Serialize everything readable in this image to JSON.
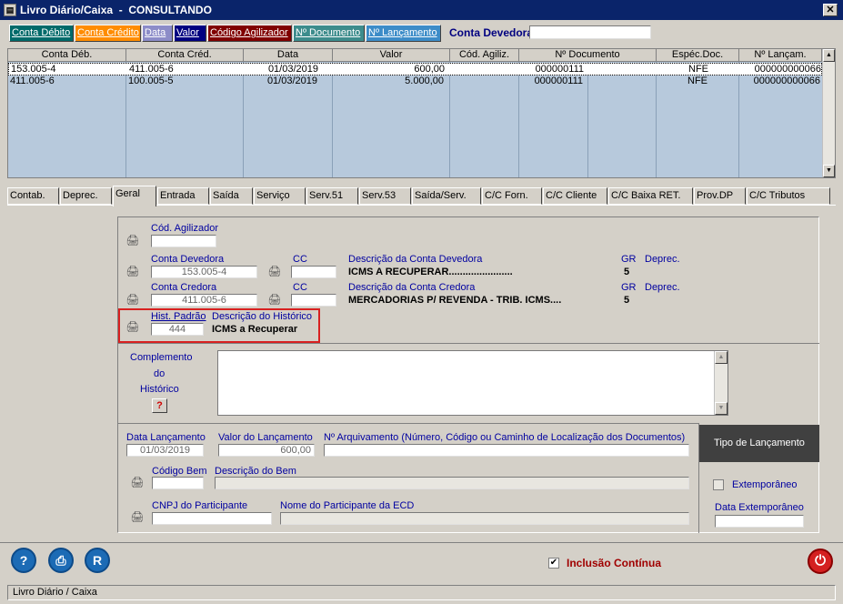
{
  "window": {
    "title": "Livro Diário/Caixa  -  CONSULTANDO",
    "app_icon": "ledger-icon",
    "close": "✕"
  },
  "sort_buttons": [
    {
      "label": "Conta Débito",
      "bg": "#006a6a",
      "fg": "#ffffff"
    },
    {
      "label": "Conta Crédito",
      "bg": "#ff8c00",
      "fg": "#ffffff"
    },
    {
      "label": "Data",
      "bg": "#8c8cc8",
      "fg": "#ffffff"
    },
    {
      "label": "Valor",
      "bg": "#000080",
      "fg": "#ffffff"
    },
    {
      "label": "Código Agilizador",
      "bg": "#800000",
      "fg": "#ffffff"
    },
    {
      "label": "Nº Documento",
      "bg": "#3c8c8c",
      "fg": "#ffffff"
    },
    {
      "label": "Nº Lançamento",
      "bg": "#3c8cc8",
      "fg": "#ffffff"
    }
  ],
  "conta_devedora_label": "Conta Devedora",
  "conta_devedora_value": "",
  "grid": {
    "headers": [
      "Conta Déb.",
      "Conta Créd.",
      "Data",
      "Valor",
      "Cód. Agiliz.",
      "Nº Documento",
      "Espéc.Doc.",
      "Nº Lançam."
    ],
    "rows": [
      [
        "153.005-4",
        "411.005-6",
        "01/03/2019",
        "600,00",
        "",
        "000000111",
        "NFE",
        "000000000066"
      ],
      [
        "411.005-6",
        "100.005-5",
        "01/03/2019",
        "5.000,00",
        "",
        "000000111",
        "NFE",
        "000000000066"
      ]
    ]
  },
  "tabs": [
    "Contab.",
    "Deprec.",
    "Geral",
    "Entrada",
    "Saída",
    "Serviço",
    "Serv.51",
    "Serv.53",
    "Saída/Serv.",
    "C/C Forn.",
    "C/C Cliente",
    "C/C Baixa RET.",
    "Prov.DP",
    "C/C Tributos"
  ],
  "form": {
    "cod_agilizador_label": "Cód. Agilizador",
    "cod_agilizador_value": "",
    "conta_devedora_label": "Conta Devedora",
    "conta_devedora_value": "153.005-4",
    "cc_label": "CC",
    "desc_devedora_label": "Descrição da Conta Devedora",
    "desc_devedora_value": "ICMS A RECUPERAR.......................",
    "gr_label": "GR",
    "gr_devedora": "5",
    "deprec_label": "Deprec.",
    "conta_credora_label": "Conta Credora",
    "conta_credora_value": "411.005-6",
    "desc_credora_label": "Descrição da Conta Credora",
    "desc_credora_value": "MERCADORIAS P/ REVENDA - TRIB. ICMS....",
    "gr_credora": "5",
    "hist_padrao_label": "Hist. Padrão",
    "hist_padrao_value": "444",
    "desc_historico_label": "Descrição do Histórico",
    "desc_historico_value": "ICMS a Recuperar",
    "complemento_l1": "Complemento",
    "complemento_l2": "do",
    "complemento_l3": "Histórico",
    "help_q": "?",
    "data_lanc_label": "Data Lançamento",
    "data_lanc_value": "01/03/2019",
    "valor_lanc_label": "Valor do Lançamento",
    "valor_lanc_value": "600,00",
    "arquivamento_label": "Nº Arquivamento (Número, Código ou Caminho de Localização dos Documentos)",
    "codigo_bem_label": "Código Bem",
    "desc_bem_label": "Descrição do Bem",
    "cnpj_label": "CNPJ do Participante",
    "nome_part_label": "Nome do Participante da ECD",
    "tipo_lanc_label": "Tipo de Lançamento",
    "extemporaneo_label": "Extemporâneo",
    "data_extemp_label": "Data Extemporâneo"
  },
  "footer": {
    "help": "?",
    "print": "⎙",
    "report": "R",
    "inclusao_label": "Inclusão Contínua",
    "inclusao_checked": "✔",
    "power": "⏻",
    "status": "Livro Diário / Caixa"
  }
}
